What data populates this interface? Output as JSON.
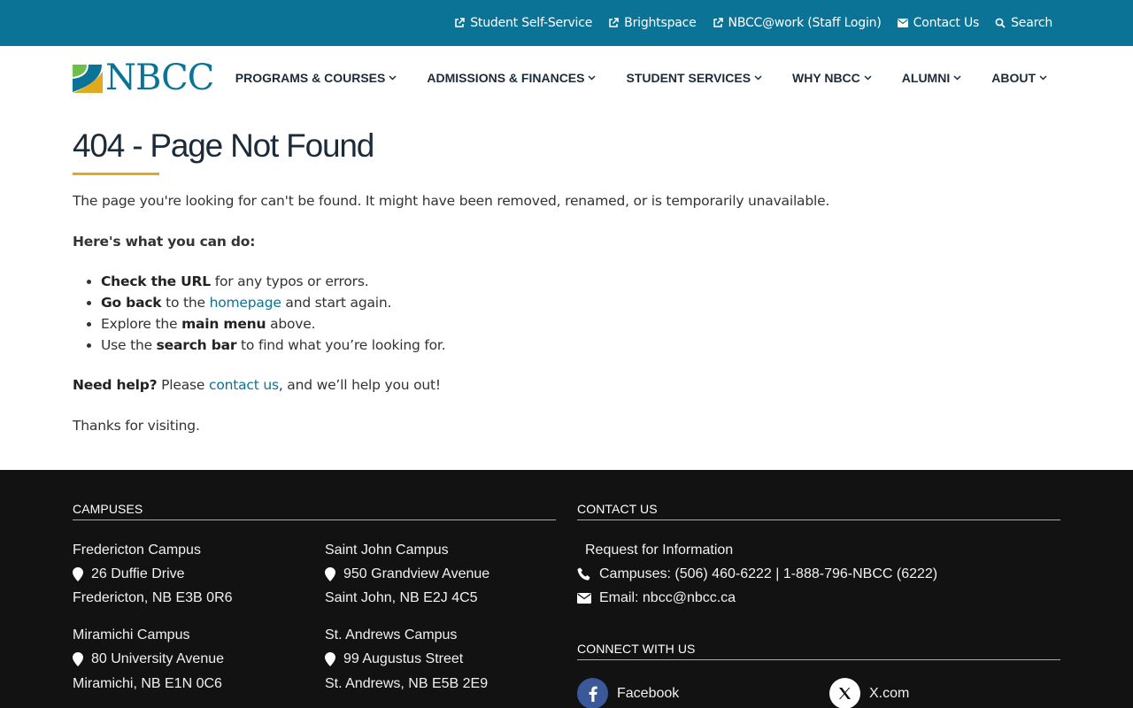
{
  "topbar": {
    "links": [
      {
        "label": "Student Self-Service",
        "icon": "external-link-icon"
      },
      {
        "label": "Brightspace",
        "icon": "external-link-icon"
      },
      {
        "label": "NBCC@work (Staff Login)",
        "icon": "external-link-icon"
      },
      {
        "label": "Contact Us",
        "icon": "envelope-icon"
      },
      {
        "label": "Search",
        "icon": "search-icon"
      }
    ]
  },
  "header": {
    "logo_text": "NBCC",
    "nav": [
      {
        "label": "PROGRAMS & COURSES"
      },
      {
        "label": "ADMISSIONS & FINANCES"
      },
      {
        "label": "STUDENT SERVICES"
      },
      {
        "label": "WHY NBCC"
      },
      {
        "label": "ALUMNI"
      },
      {
        "label": "ABOUT"
      }
    ]
  },
  "main": {
    "title": "404 - Page Not Found",
    "intro": "The page you're looking for can't be found. It might have been removed, renamed, or is temporarily unavailable.",
    "todo_heading": "Here's what you can do:",
    "list": {
      "item1_bold": "Check the URL",
      "item1_rest": " for any typos or errors.",
      "item2_bold": "Go back",
      "item2_mid": " to the ",
      "item2_link": "homepage",
      "item2_rest": " and start again.",
      "item3_pre": "Explore the ",
      "item3_bold": "main menu",
      "item3_rest": " above.",
      "item4_pre": "Use the ",
      "item4_bold": "search bar",
      "item4_rest": " to find what you’re looking for."
    },
    "help_bold": "Need help?",
    "help_pre": " Please ",
    "help_link": "contact us",
    "help_rest": ", and we’ll help you out!",
    "thanks": "Thanks for visiting."
  },
  "footer": {
    "campuses_heading": "CAMPUSES",
    "campuses": [
      {
        "name": "Fredericton Campus",
        "street": "26 Duffie Drive",
        "city": "Fredericton, NB  E3B 0R6"
      },
      {
        "name": "Saint John Campus",
        "street": "950 Grandview Avenue",
        "city": "Saint John, NB  E2J 4C5"
      },
      {
        "name": "Miramichi Campus",
        "street": "80 University Avenue",
        "city": "Miramichi, NB  E1N 0C6"
      },
      {
        "name": "St. Andrews Campus",
        "street": "99 Augustus Street",
        "city": "St. Andrews, NB  E5B 2E9"
      }
    ],
    "contact_heading": "CONTACT US",
    "request_info": "Request for Information",
    "phone": "Campuses: (506) 460-6222 |  1-888-796-NBCC (6222)",
    "email": "Email: nbcc@nbcc.ca",
    "connect_heading": "CONNECT WITH US",
    "social": [
      {
        "label": "Facebook",
        "icon": "facebook-icon"
      },
      {
        "label": "X.com",
        "icon": "x-icon"
      }
    ]
  },
  "colors": {
    "brand_teal": "#0a7396",
    "accent_gold": "#e2a91c",
    "footer_bg": "#121212",
    "facebook_blue": "#3b5998"
  }
}
